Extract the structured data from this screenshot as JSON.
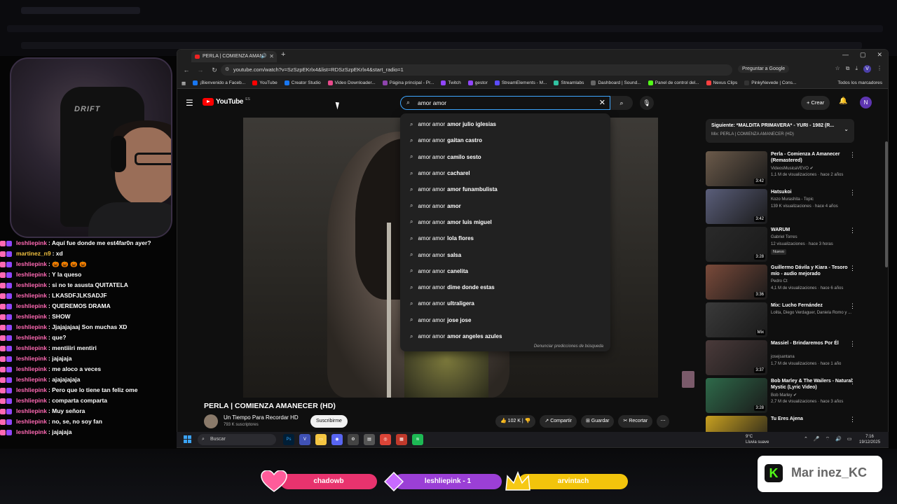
{
  "webcam": {
    "chair_label": "DRIFT"
  },
  "chat": [
    {
      "user": "leshliepink",
      "msg": ": Aquí fue donde me est4far0n ayer?",
      "color": "#ff69b4"
    },
    {
      "user": "martinez_n9",
      "msg": ": xd",
      "color": "#f0c040"
    },
    {
      "user": "leshliepink",
      "msg": ": 🎃 🎃 🎃 🎃",
      "color": "#ff69b4"
    },
    {
      "user": "leshliepink",
      "msg": ": Y la queso",
      "color": "#ff69b4"
    },
    {
      "user": "leshliepink",
      "msg": ": si no te asusta QUITATELA",
      "color": "#ff69b4"
    },
    {
      "user": "leshliepink",
      "msg": ": LKASDFJLKSADJF",
      "color": "#ff69b4"
    },
    {
      "user": "leshliepink",
      "msg": ": QUEREMOS DRAMA",
      "color": "#ff69b4"
    },
    {
      "user": "leshliepink",
      "msg": ": SHOW",
      "color": "#ff69b4"
    },
    {
      "user": "leshliepink",
      "msg": ": Jjajajajaaj Son muchas XD",
      "color": "#ff69b4"
    },
    {
      "user": "leshliepink",
      "msg": ": que?",
      "color": "#ff69b4"
    },
    {
      "user": "leshliepink",
      "msg": ": mentiiiri mentiri",
      "color": "#ff69b4"
    },
    {
      "user": "leshliepink",
      "msg": ": jajajaja",
      "color": "#ff69b4"
    },
    {
      "user": "leshliepink",
      "msg": ": me aloco a veces",
      "color": "#ff69b4"
    },
    {
      "user": "leshliepink",
      "msg": ": ajajajajaja",
      "color": "#ff69b4"
    },
    {
      "user": "leshliepink",
      "msg": ": Pero que lo tiene tan feliz ome",
      "color": "#ff69b4"
    },
    {
      "user": "leshliepink",
      "msg": ": comparta comparta",
      "color": "#ff69b4"
    },
    {
      "user": "leshliepink",
      "msg": ": Muy señora",
      "color": "#ff69b4"
    },
    {
      "user": "leshliepink",
      "msg": ": no, se, no soy fan",
      "color": "#ff69b4"
    },
    {
      "user": "leshliepink",
      "msg": ": jajajaja",
      "color": "#ff69b4"
    }
  ],
  "browser": {
    "tab_title": "PERLA | COMIENZA AMAN",
    "url": "youtube.com/watch?v=SzSzpEKrlx4&list=RDSzSzpEKrlx4&start_radio=1",
    "ask_google": "Preguntar a Google",
    "profile_initial": "V",
    "bookmarks": [
      {
        "label": "¡Bienvenido a Faceb...",
        "color": "#1877f2"
      },
      {
        "label": "YouTube",
        "color": "#ff0000"
      },
      {
        "label": "Creator Studio",
        "color": "#1877f2"
      },
      {
        "label": "Video Downloader...",
        "color": "#e94a8c"
      },
      {
        "label": "Página principal - Pr...",
        "color": "#8e44ad"
      },
      {
        "label": "Twitch",
        "color": "#9146ff"
      },
      {
        "label": "gestor",
        "color": "#9146ff"
      },
      {
        "label": "StreamElements - M...",
        "color": "#5b4cff"
      },
      {
        "label": "Streamlabs",
        "color": "#31c3a2"
      },
      {
        "label": "Dashboard | Sound...",
        "color": "#666666"
      },
      {
        "label": "Panel de control del...",
        "color": "#53fc18"
      },
      {
        "label": "Nexus Clips",
        "color": "#ff4040"
      },
      {
        "label": "PinkyNevede | Cons...",
        "color": "#333333"
      }
    ],
    "all_bookmarks": "Todos los marcadores"
  },
  "youtube": {
    "logo_text": "YouTube",
    "logo_cc": "ES",
    "search_value": "amor amor",
    "create_label": "Crear",
    "avatar_initial": "N",
    "suggestions": [
      {
        "pre": "amor amor",
        "post": "amor julio iglesias"
      },
      {
        "pre": "amor amor",
        "post": "gaitan castro"
      },
      {
        "pre": "amor amor",
        "post": "camilo sesto"
      },
      {
        "pre": "amor amor",
        "post": "cacharel"
      },
      {
        "pre": "amor amor",
        "post": "amor funambulista"
      },
      {
        "pre": "amor amor",
        "post": "amor"
      },
      {
        "pre": "amor amor",
        "post": "amor luis miguel"
      },
      {
        "pre": "amor amor",
        "post": "lola flores"
      },
      {
        "pre": "amor amor",
        "post": "salsa"
      },
      {
        "pre": "amor amor",
        "post": "canelita"
      },
      {
        "pre": "amor amor",
        "post": "dime donde estas"
      },
      {
        "pre": "amor amor",
        "post": "ultraligera"
      },
      {
        "pre": "amor amor",
        "post": "jose jose"
      },
      {
        "pre": "amor amor",
        "post": "amor angeles azules"
      }
    ],
    "report_predictions": "Denunciar predicciones de búsqueda",
    "video_title": "PERLA | COMIENZA AMANECER (HD)",
    "channel_name": "Un Tiempo Para Recordar HD",
    "channel_subs": "793 K suscriptores",
    "subscribe_label": "Suscribirme",
    "likes": "102 K",
    "share_label": "Compartir",
    "save_label": "Guardar",
    "clip_label": "Recortar",
    "next": {
      "title": "Siguiente: *MALDITA PRIMAVERA* - YURI - 1982 (R...",
      "subtitle": "Mix: PERLA | COMIENZA AMANECER (HD)"
    },
    "recommendations": [
      {
        "title": "Perla - Comienza A Amanecer (Remastered)",
        "channel": "VideosMusicaVEVO ✔",
        "meta": "1,1 M de visualizaciones · hace 2 años",
        "duration": "3:42",
        "thumb": "#6b5a4a",
        "badge": ""
      },
      {
        "title": "Hatsukoi",
        "channel": "Kozo Murashita - Topic",
        "meta": "139 K visualizaciones · hace 4 años",
        "duration": "3:42",
        "thumb": "#5a5e7a",
        "badge": ""
      },
      {
        "title": "WARUM",
        "channel": "Gabriel Torres",
        "meta": "12 visualizaciones · hace 3 horas",
        "duration": "3:28",
        "thumb": "#2a2a2a",
        "badge": "Nuevo"
      },
      {
        "title": "Guillermo Dávila y Kiara - Tesoro mío - audio mejorado",
        "channel": "Pedro Ct",
        "meta": "4,1 M de visualizaciones · hace 6 años",
        "duration": "3:36",
        "thumb": "#7a4a3a",
        "badge": ""
      },
      {
        "title": "Mix: Lucho Fernández",
        "channel": "Lolita, Diego Verdaguer, Daniela Romo y ...",
        "meta": "",
        "duration": "Mix",
        "thumb": "#3a3a3a",
        "badge": ""
      },
      {
        "title": "Massiel - Brindaremos Por Él",
        "channel": "josejsantana",
        "meta": "1,7 M de visualizaciones · hace 1 año",
        "duration": "3:37",
        "thumb": "#4a3a3a",
        "badge": ""
      },
      {
        "title": "Bob Marley & The Wailers - Natural Mystic (Lyric Video)",
        "channel": "Bob Marley ✔",
        "meta": "2,7 M de visualizaciones · hace 3 años",
        "duration": "3:28",
        "thumb": "#2e6a4a",
        "badge": ""
      },
      {
        "title": "Tu Eres Ajena",
        "channel": "",
        "meta": "",
        "duration": "",
        "thumb": "#c8a020",
        "badge": ""
      }
    ]
  },
  "taskbar": {
    "search_label": "Buscar",
    "weather_temp": "9°C",
    "weather_desc": "Lluvia suave",
    "time": "7:16",
    "date": "19/12/2025"
  },
  "alerts": {
    "a1": "chadowb",
    "a2": "leshliepink - 1",
    "a3": "arvintach",
    "kick_name": "Mar  inez_KC",
    "kick_logo": "K"
  },
  "colors": {
    "accent_search": "#3ea6ff",
    "alert_pink": "#e8336e",
    "alert_purple": "#9b3fd6",
    "alert_yellow": "#f2c40c"
  }
}
